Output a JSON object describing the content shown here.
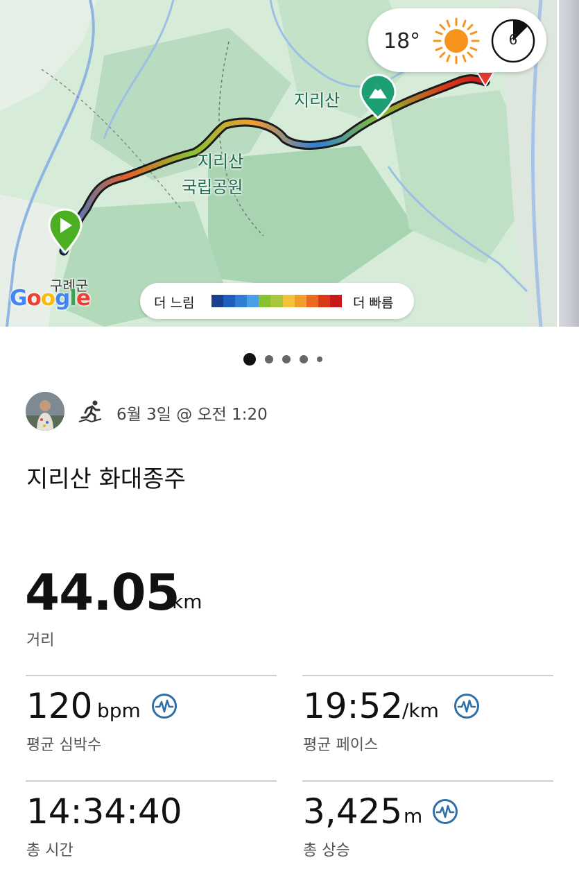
{
  "map": {
    "weather": {
      "temp": "18°",
      "sun_icon": "sun-icon",
      "dial_value": "6"
    },
    "labels": {
      "peak": "지리산",
      "park_line1": "지리산",
      "park_line2": "국립공원",
      "city": "구례군"
    },
    "legend": {
      "slow": "더 느림",
      "fast": "더 빠름",
      "colors": [
        "#1a3f8f",
        "#1f5fbf",
        "#2f7fd6",
        "#4aa0e6",
        "#86c232",
        "#a6c83a",
        "#f2c23a",
        "#f39c2e",
        "#ea6a1f",
        "#d83a1a",
        "#c8191a"
      ]
    },
    "attribution": "Google",
    "start_marker_icon": "play-icon",
    "peak_marker_icon": "mountain-icon"
  },
  "pager": {
    "count": 5,
    "active": 0
  },
  "activity": {
    "avatar_icon": "avatar",
    "type_icon": "trail-run-icon",
    "date": "6월 3일 @ 오전 1:20",
    "title": "지리산 화대종주"
  },
  "stats": {
    "distance": {
      "value": "44.05",
      "unit": "km",
      "label": "거리"
    },
    "heart_rate": {
      "value": "120",
      "unit": "bpm",
      "label": "평균 심박수",
      "icon": "heart-rate-icon"
    },
    "pace": {
      "value": "19:52",
      "unit": "/km",
      "label": "평균 페이스",
      "icon": "heart-rate-icon"
    },
    "time": {
      "value": "14:34:40",
      "label": "총 시간"
    },
    "ascent": {
      "value": "3,425",
      "unit": "m",
      "label": "총 상승",
      "icon": "heart-rate-icon"
    }
  },
  "colors": {
    "accent_blue": "#2e6fa7",
    "start_green": "#4caf23",
    "end_red": "#e23a2e"
  }
}
